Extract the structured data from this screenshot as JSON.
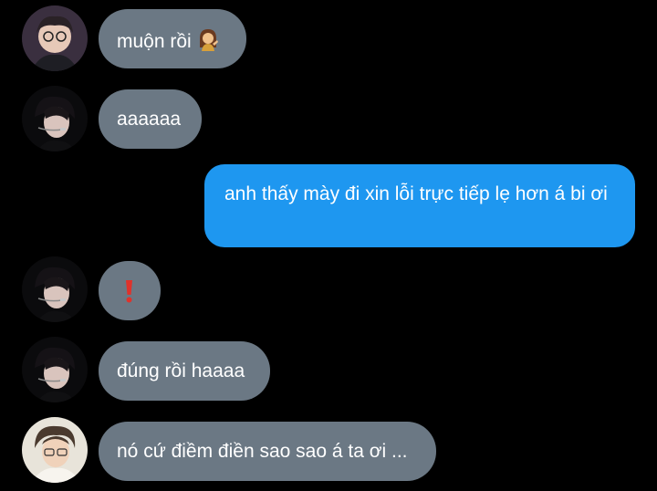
{
  "conversation": {
    "messages": [
      {
        "id": "m1",
        "direction": "incoming",
        "sender": "user-a",
        "text": "muộn rồi",
        "emoji": "woman-tipping-hand"
      },
      {
        "id": "m2",
        "direction": "incoming",
        "sender": "user-b",
        "text": "aaaaaa"
      },
      {
        "id": "m3",
        "direction": "outgoing",
        "text": "anh thấy mày đi xin lỗi trực tiếp lẹ hơn á bi ơi"
      },
      {
        "id": "m4",
        "direction": "incoming",
        "sender": "user-b",
        "text": "",
        "emoji": "exclamation-mark"
      },
      {
        "id": "m5",
        "direction": "incoming",
        "sender": "user-b",
        "text": "đúng rồi haaaa"
      },
      {
        "id": "m6",
        "direction": "incoming",
        "sender": "user-c",
        "text": "nó cứ điềm điền sao sao á ta ơi ..."
      }
    ]
  },
  "colors": {
    "background": "#000000",
    "incoming_bubble": "#6b7884",
    "outgoing_bubble": "#1e97f0",
    "text": "#ffffff",
    "exclamation": "#e0322b"
  }
}
